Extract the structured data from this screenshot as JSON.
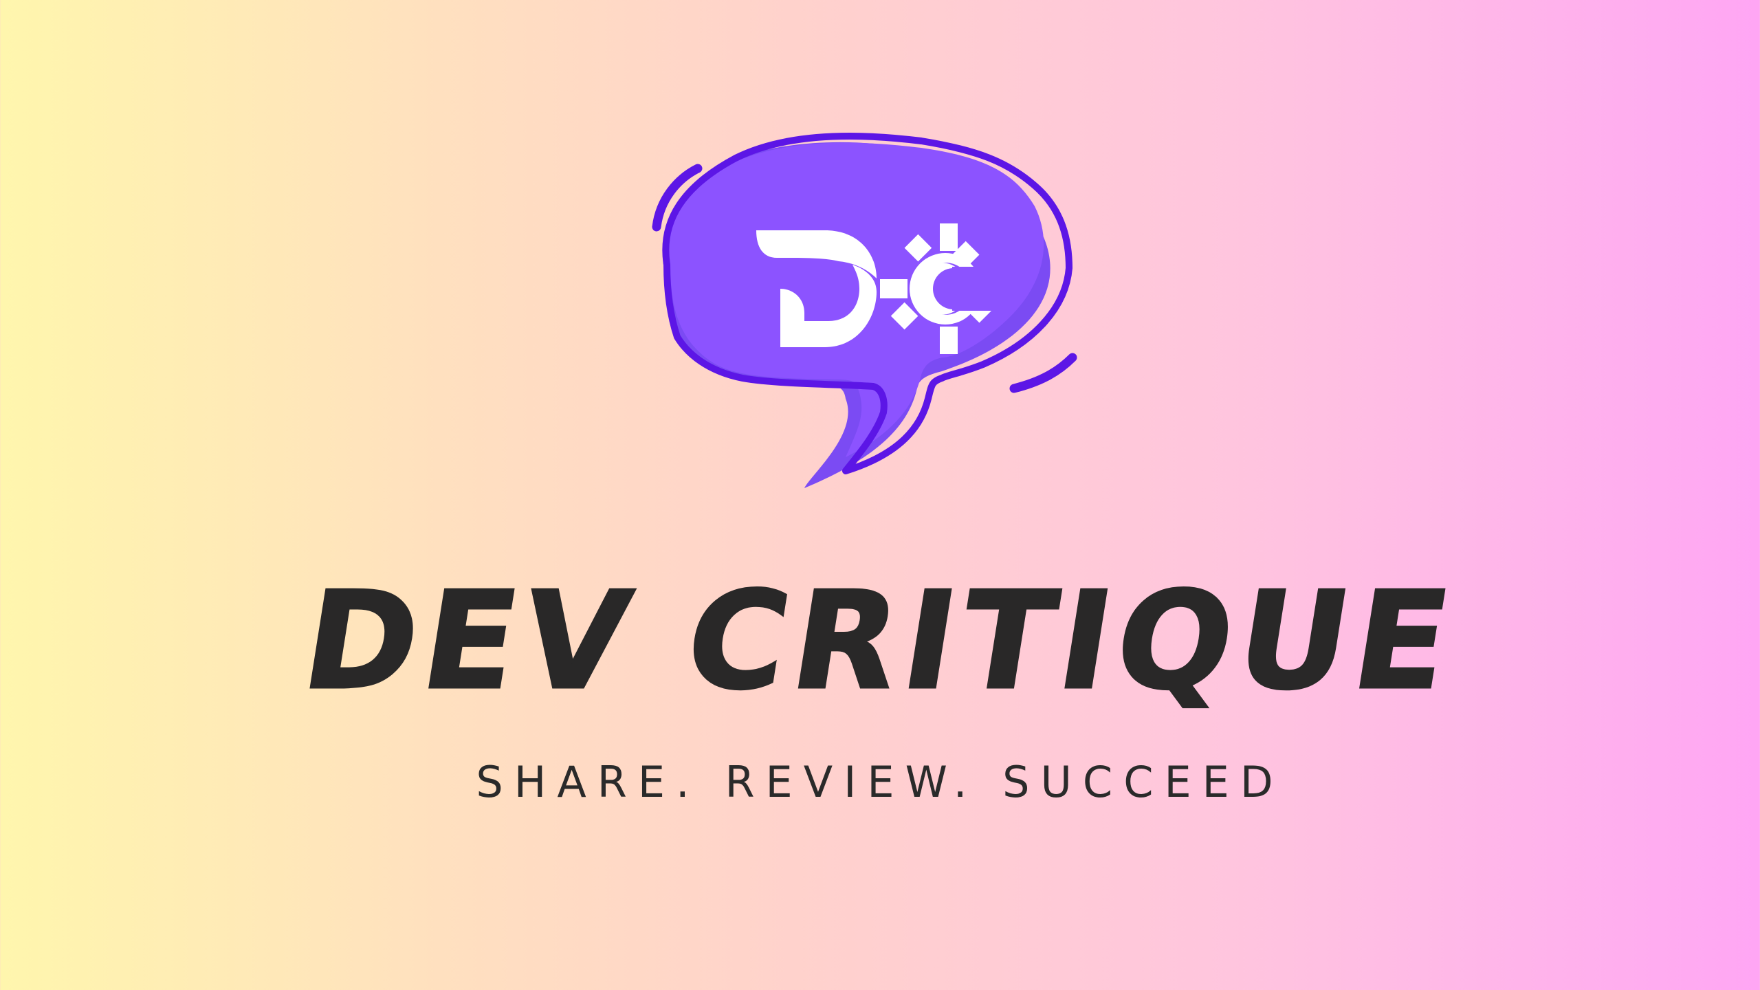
{
  "brand": {
    "title": "DEV CRITIQUE",
    "tagline": "SHARE. REVIEW. SUCCEED"
  },
  "logo": {
    "icon": "speech-bubble-dc-gear-icon",
    "colors": {
      "bubble_fill": "#8c53ff",
      "bubble_shadow": "#7b4bf3",
      "outline": "#5c16e6",
      "glyph": "#ffffff"
    }
  },
  "text_color": "#292828",
  "background_gradient": [
    "#fff6ad",
    "#ffe0bf",
    "#ffd2cc",
    "#ffc5de",
    "#ffa6f4"
  ]
}
